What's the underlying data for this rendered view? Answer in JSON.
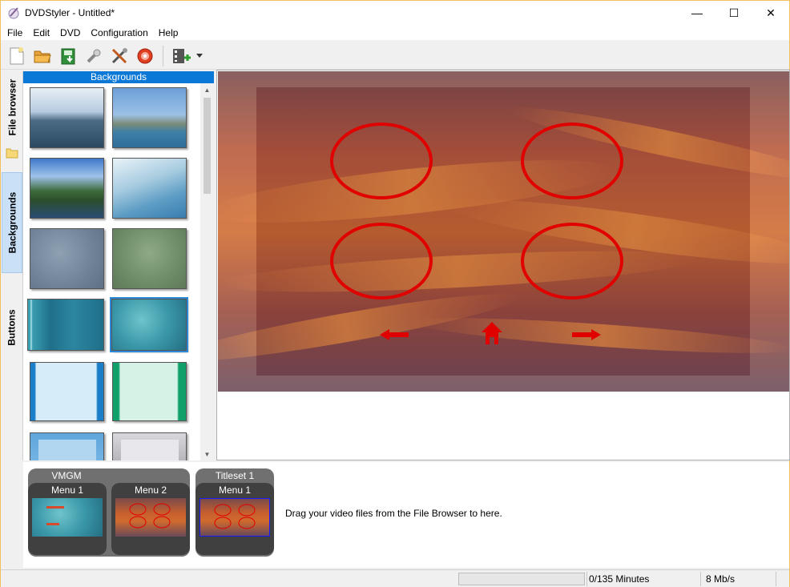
{
  "window": {
    "title": "DVDStyler - Untitled*",
    "minimize_glyph": "—",
    "maximize_glyph": "☐",
    "close_glyph": "✕"
  },
  "menubar": {
    "items": [
      "File",
      "Edit",
      "DVD",
      "Configuration",
      "Help"
    ]
  },
  "toolbar": {
    "icons": [
      "new-icon",
      "open-icon",
      "save-icon",
      "settings-icon",
      "tools-icon",
      "burn-icon",
      "add-video-icon"
    ]
  },
  "left_tabs": {
    "file_browser": "File browser",
    "backgrounds": "Backgrounds",
    "buttons": "Buttons"
  },
  "panel": {
    "header": "Backgrounds"
  },
  "titleset": {
    "vmgm_label": "VMGM",
    "titleset_label": "Titleset 1",
    "vmgm_menus": [
      "Menu 1",
      "Menu 2"
    ],
    "titleset_menus": [
      "Menu 1"
    ],
    "hint": "Drag your video files from the File Browser to here."
  },
  "status": {
    "duration": "0/135 Minutes",
    "bitrate": "8 Mb/s",
    "progress": 0
  },
  "colors": {
    "accent": "#0a78d7",
    "button_red": "#e00000"
  }
}
